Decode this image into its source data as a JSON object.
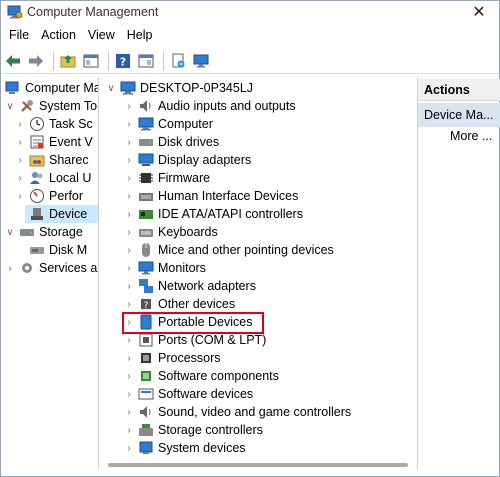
{
  "window": {
    "title": "Computer Management",
    "close_glyph": "✕"
  },
  "menu": [
    "File",
    "Action",
    "View",
    "Help"
  ],
  "toolbar": [
    "back-arrow-icon",
    "forward-arrow-icon",
    "up-folder-icon",
    "show-hide-tree-icon",
    "help-icon",
    "properties-icon",
    "export-icon",
    "monitor-icon"
  ],
  "left_tree": [
    {
      "label": "Computer Ma",
      "icon": "computer-management-icon"
    },
    {
      "label": "System To",
      "icon": "system-tools-icon"
    },
    {
      "label": "Task Sc",
      "icon": "task-scheduler-icon"
    },
    {
      "label": "Event V",
      "icon": "event-viewer-icon"
    },
    {
      "label": "Sharec",
      "icon": "shared-folders-icon"
    },
    {
      "label": "Local U",
      "icon": "local-users-icon"
    },
    {
      "label": "Perfor",
      "icon": "performance-icon"
    },
    {
      "label": "Device",
      "icon": "device-manager-icon"
    },
    {
      "label": "Storage",
      "icon": "storage-icon"
    },
    {
      "label": "Disk M",
      "icon": "disk-management-icon"
    },
    {
      "label": "Services ar",
      "icon": "services-icon"
    }
  ],
  "device_tree": {
    "root": "DESKTOP-0P345LJ",
    "categories": [
      "Audio inputs and outputs",
      "Computer",
      "Disk drives",
      "Display adapters",
      "Firmware",
      "Human Interface Devices",
      "IDE ATA/ATAPI controllers",
      "Keyboards",
      "Mice and other pointing devices",
      "Monitors",
      "Network adapters",
      "Other devices",
      "Portable Devices",
      "Ports (COM & LPT)",
      "Processors",
      "Software components",
      "Software devices",
      "Sound, video and game controllers",
      "Storage controllers",
      "System devices"
    ],
    "highlighted": "Portable Devices"
  },
  "actions": {
    "header": "Actions",
    "selected": "Device Ma...",
    "more": "More ..."
  },
  "colors": {
    "highlight_border": "#e0001b",
    "selection": "#cce8ff",
    "actions_selected": "#d8e4f0"
  }
}
